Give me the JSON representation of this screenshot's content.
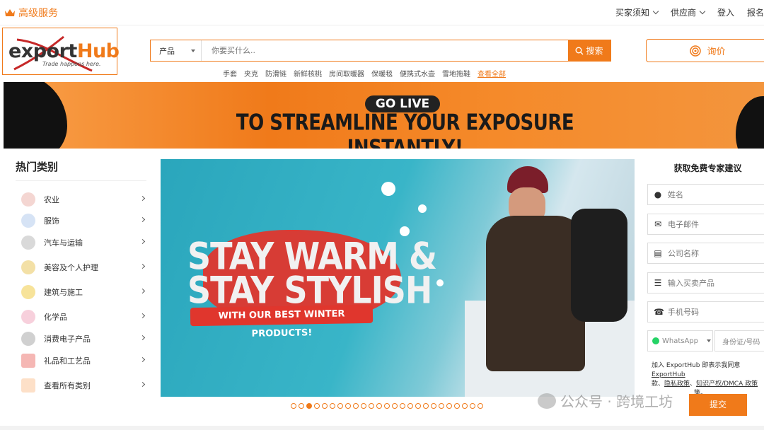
{
  "topbar": {
    "premium_label": "高级服务",
    "links": [
      {
        "label": "买家须知",
        "has_dropdown": true
      },
      {
        "label": "供应商",
        "has_dropdown": true
      },
      {
        "label": "登入",
        "has_dropdown": false
      },
      {
        "label": "报名",
        "has_dropdown": false
      }
    ]
  },
  "logo": {
    "ex": "ex",
    "port": "port",
    "hub": "Hub",
    "tagline": "Trade happens here."
  },
  "search": {
    "category": "产品",
    "placeholder": "你要买什么..",
    "button": "搜索",
    "hot_words": [
      "手套",
      "夹克",
      "防滑链",
      "新鲜核桃",
      "房间取暖器",
      "保暖毯",
      "便携式水壶",
      "雪地拖鞋"
    ],
    "view_all": "查看全部"
  },
  "inquiry_button": "询价",
  "banner": {
    "badge": "GO LIVE",
    "headline": "TO STREAMLINE YOUR EXPOSURE INSTANTLY!"
  },
  "categories": {
    "title": "热门类别",
    "items": [
      {
        "label": "农业",
        "icon": "tractor-icon",
        "color": "#c0392b"
      },
      {
        "label": "服饰",
        "icon": "shirt-icon",
        "color": "#7ea7d8"
      },
      {
        "label": "汽车与运输",
        "icon": "gear-icon",
        "color": "#888888"
      },
      {
        "label": "美容及个人护理",
        "icon": "lipstick-icon",
        "color": "#d4a017"
      },
      {
        "label": "建筑与施工",
        "icon": "excavator-icon",
        "color": "#f0c419"
      },
      {
        "label": "化学品",
        "icon": "flask-icon",
        "color": "#e86a8f"
      },
      {
        "label": "消费电子产品",
        "icon": "electronics-icon",
        "color": "#555555"
      },
      {
        "label": "礼品和工艺品",
        "icon": "gift-icon",
        "color": "#e53935"
      },
      {
        "label": "查看所有类别",
        "icon": "grid-icon",
        "color": "#f07a1a"
      }
    ]
  },
  "carousel": {
    "line1": "STAY WARM &",
    "line2": "STAY STYLISH",
    "promo": "WITH OUR BEST WINTER PRODUCTS!",
    "slide_count": 25,
    "active_slide": 3
  },
  "form": {
    "title": "获取免费专家建议",
    "fields": [
      {
        "placeholder": "姓名",
        "icon": "user-icon"
      },
      {
        "placeholder": "电子邮件",
        "icon": "envelope-icon"
      },
      {
        "placeholder": "公司名称",
        "icon": "building-icon"
      },
      {
        "placeholder": "输入买卖产品",
        "icon": "list-icon"
      },
      {
        "placeholder": "手机号码",
        "icon": "phone-icon"
      }
    ],
    "whatsapp": "WhatsApp",
    "id_placeholder": "身份证/号码",
    "terms_prefix": "加入 ExportHub 即表示我同意",
    "terms_link1": "ExportHub",
    "terms_link2": "款",
    "terms_link3": "隐私政策",
    "terms_link4": "知识产权/DMCA 政策",
    "terms_suffix": "策。",
    "submit": "提交"
  },
  "watermark": "公众号 · 跨境工坊",
  "colors": {
    "accent": "#f07a1a",
    "banner_dark": "#1a1a1a"
  }
}
